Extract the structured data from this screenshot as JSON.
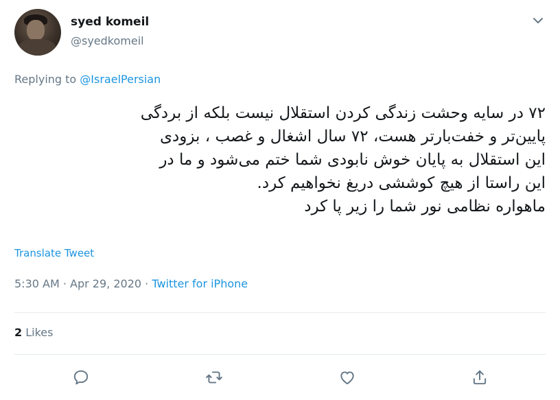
{
  "author": {
    "display_name": "syed komeil",
    "username": "@syedkomeil"
  },
  "reply": {
    "prefix": "Replying to",
    "mention": "@IsraelPersian"
  },
  "tweet": {
    "lines": [
      "۷۲ در سایه وحشت زندگی کردن استقلال نیست بلکه از بردگی",
      "پایین‌تر و خفت‌بارتر هست، ۷۲ سال اشغال و غصب ، بزودی",
      "این استقلال به پایان خوش نابودی شما ختم می‌شود و ما در",
      "این راستا از هیچ کوششی دریغ نخواهیم کرد.",
      "ماهواره نظامی نور شما را زیر پا کرد"
    ]
  },
  "translate_label": "Translate Tweet",
  "meta": {
    "time": "5:30 AM",
    "sep1": " · ",
    "date": "Apr 29, 2020",
    "sep2": " · ",
    "source": "Twitter for iPhone"
  },
  "stats": {
    "likes_count": "2",
    "likes_label": "Likes"
  },
  "icons": {
    "more": "chevron-down-icon",
    "reply": "reply-icon",
    "retweet": "retweet-icon",
    "like": "heart-icon",
    "share": "share-icon"
  },
  "colors": {
    "accent": "#1b95e0",
    "secondary_text": "#657786",
    "primary_text": "#14171a",
    "divider": "#e6ecf0"
  }
}
